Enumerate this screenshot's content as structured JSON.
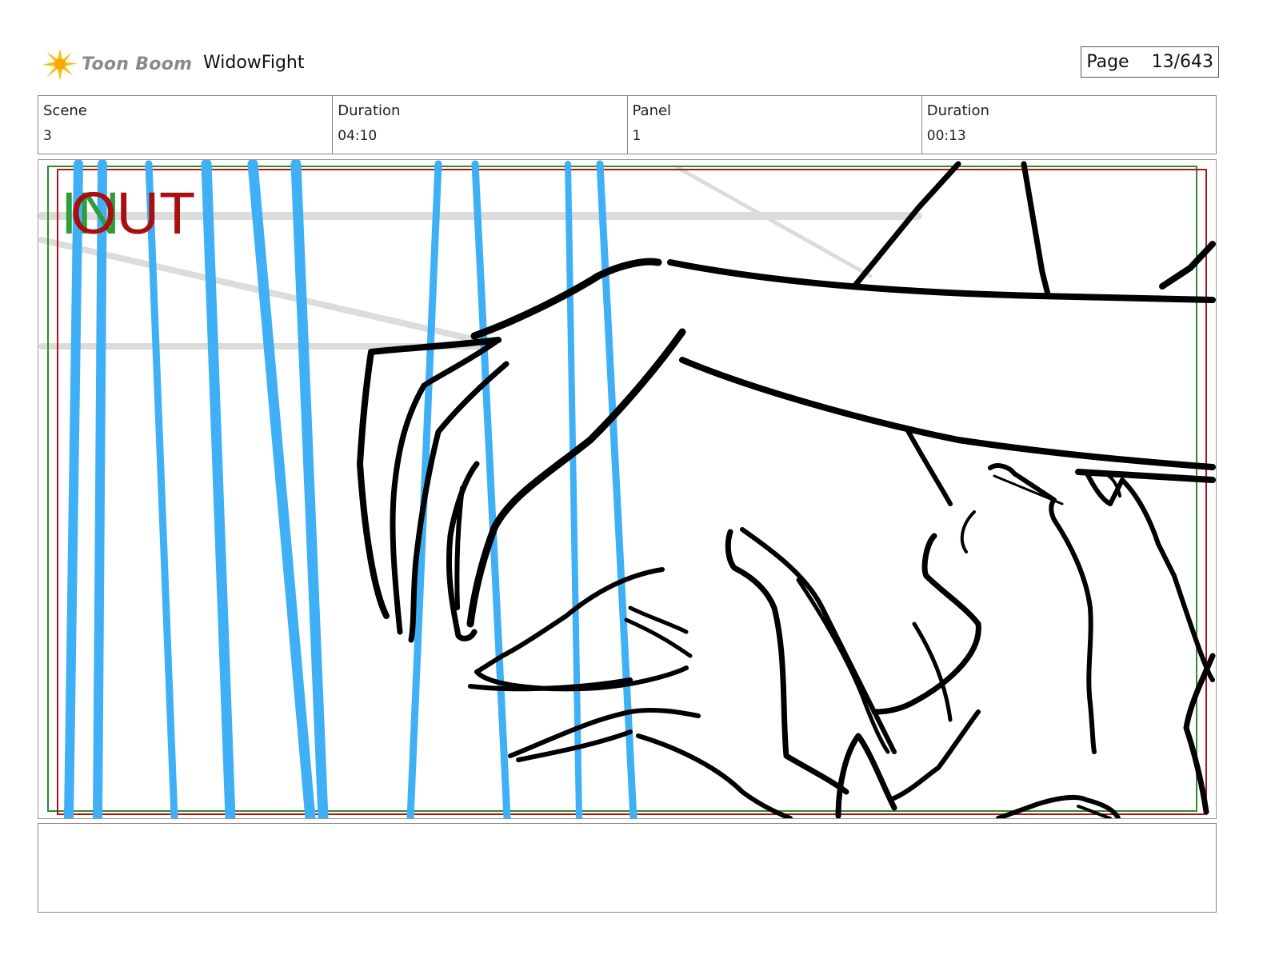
{
  "header": {
    "logo_text": "Toon Boom",
    "project_title": "WidowFight",
    "page_label": "Page",
    "page_number": "13/643"
  },
  "info": {
    "scene_label": "Scene",
    "scene_value": "3",
    "scene_duration_label": "Duration",
    "scene_duration_value": "04:10",
    "panel_label": "Panel",
    "panel_value": "1",
    "panel_duration_label": "Duration",
    "panel_duration_value": "00:13"
  },
  "panel": {
    "in_marker": "IN",
    "out_marker": "OUT"
  },
  "colors": {
    "in_green": "#2e9d3a",
    "out_red": "#a80f0f",
    "blue_lines": "#3fb0f5",
    "ink": "#000000"
  },
  "caption": {
    "text": ""
  }
}
